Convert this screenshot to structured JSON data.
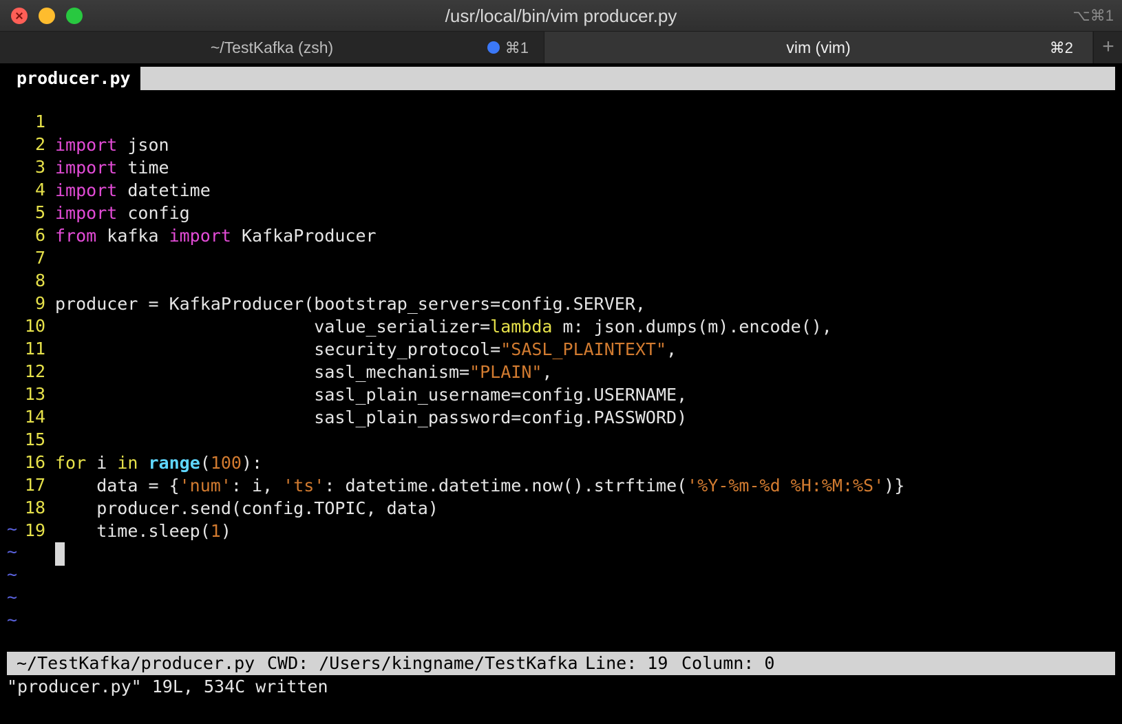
{
  "window": {
    "title": "/usr/local/bin/vim producer.py",
    "shortcut": "⌥⌘1"
  },
  "tabs": [
    {
      "label": "~/TestKafka (zsh)",
      "shortcut": "⌘1",
      "active": false,
      "activity_dot": true
    },
    {
      "label": "vim (vim)",
      "shortcut": "⌘2",
      "active": true
    }
  ],
  "newtab_label": "+",
  "editor": {
    "buffer_tab": "producer.py",
    "lines": [
      {
        "n": "1"
      },
      {
        "n": "2"
      },
      {
        "n": "3"
      },
      {
        "n": "4"
      },
      {
        "n": "5"
      },
      {
        "n": "6"
      },
      {
        "n": "7"
      },
      {
        "n": "8"
      },
      {
        "n": "9"
      },
      {
        "n": "10"
      },
      {
        "n": "11"
      },
      {
        "n": "12"
      },
      {
        "n": "13"
      },
      {
        "n": "14"
      },
      {
        "n": "15"
      },
      {
        "n": "16"
      },
      {
        "n": "17"
      },
      {
        "n": "18"
      },
      {
        "n": "19"
      }
    ],
    "code": {
      "l1": [
        "import",
        " json"
      ],
      "l2": [
        "import",
        " time"
      ],
      "l3": [
        "import",
        " datetime"
      ],
      "l4": [
        "import",
        " config"
      ],
      "l5": [
        "from",
        " kafka ",
        "import",
        " KafkaProducer"
      ],
      "l8": "producer = KafkaProducer(bootstrap_servers=config.SERVER,",
      "l9": [
        "                         value_serializer=",
        "lambda",
        " m: json.dumps(m).encode(),"
      ],
      "l10": [
        "                         security_protocol=",
        "\"SASL_PLAINTEXT\"",
        ","
      ],
      "l11": [
        "                         sasl_mechanism=",
        "\"PLAIN\"",
        ","
      ],
      "l12": "                         sasl_plain_username=config.USERNAME,",
      "l13": "                         sasl_plain_password=config.PASSWORD)",
      "l15": [
        "for",
        " i ",
        "in",
        " ",
        "range",
        "(",
        "100",
        "):"
      ],
      "l16": [
        "    data = {",
        "'num'",
        ": i, ",
        "'ts'",
        ": datetime.datetime.now().strftime(",
        "'%Y-%m-%d %H:%M:%S'",
        ")}"
      ],
      "l17": "    producer.send(config.TOPIC, data)",
      "l18": [
        "    time.sleep(",
        "1",
        ")"
      ]
    },
    "tilde": "~"
  },
  "status": {
    "path": "~/TestKafka/producer.py",
    "cwd": "CWD: /Users/kingname/TestKafka",
    "line": "Line: 19",
    "column": "Column: 0"
  },
  "message": "\"producer.py\" 19L, 534C written",
  "colors": {
    "keyword": "#e24bd6",
    "string": "#d27b30",
    "line_number": "#e6e14a",
    "builtin": "#5fd7ff",
    "tilde": "#5b63e0"
  }
}
